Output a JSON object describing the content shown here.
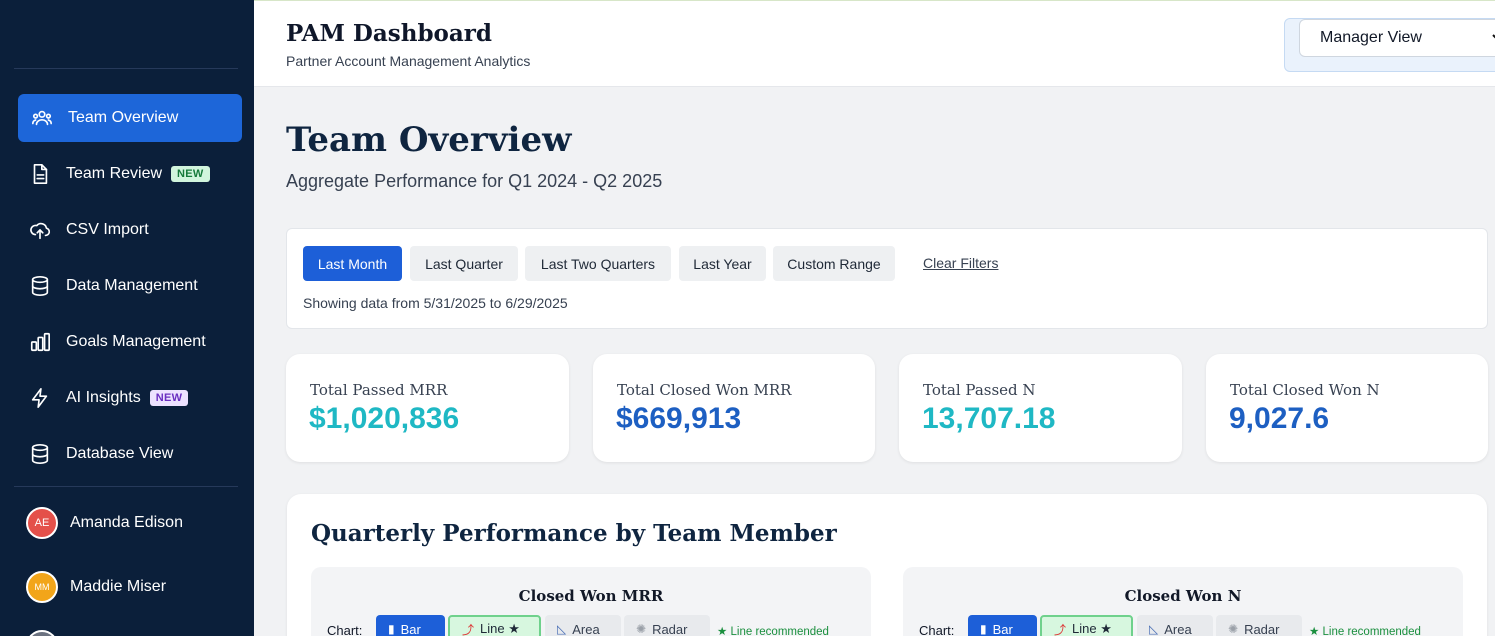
{
  "sidebar": {
    "items": [
      {
        "label": "Team Overview",
        "icon": "users-icon",
        "badge": ""
      },
      {
        "label": "Team Review",
        "icon": "document-icon",
        "badge": "NEW"
      },
      {
        "label": "CSV Import",
        "icon": "cloud-upload-icon",
        "badge": ""
      },
      {
        "label": "Data Management",
        "icon": "database-icon",
        "badge": ""
      },
      {
        "label": "Goals Management",
        "icon": "bar-chart-icon",
        "badge": ""
      },
      {
        "label": "AI Insights",
        "icon": "lightning-icon",
        "badge": "NEW"
      },
      {
        "label": "Database View",
        "icon": "database-icon",
        "badge": ""
      }
    ],
    "users": [
      {
        "initials": "AE",
        "name": "Amanda Edison",
        "color": "#e4504a"
      },
      {
        "initials": "MM",
        "name": "Maddie Miser",
        "color": "#f2a51a"
      }
    ]
  },
  "header": {
    "title": "PAM Dashboard",
    "subtitle": "Partner Account Management Analytics",
    "view_select": "Manager View"
  },
  "main": {
    "title": "Team Overview",
    "subtitle": "Aggregate Performance for Q1 2024 - Q2 2025",
    "filters": {
      "buttons": [
        "Last Month",
        "Last Quarter",
        "Last Two Quarters",
        "Last Year",
        "Custom Range"
      ],
      "active": "Last Month",
      "clear": "Clear Filters",
      "note": "Showing data from 5/31/2025 to 6/29/2025"
    },
    "kpis": [
      {
        "label": "Total Passed MRR",
        "value": "$1,020,836",
        "color": "#1fb8c4"
      },
      {
        "label": "Total Closed Won MRR",
        "value": "$669,913",
        "color": "#1d5fc2"
      },
      {
        "label": "Total Passed N",
        "value": "13,707.18",
        "color": "#1fb8c4"
      },
      {
        "label": "Total Closed Won N",
        "value": "9,027.6",
        "color": "#1d5fc2"
      }
    ],
    "performance": {
      "title": "Quarterly Performance by Team Member",
      "panels": [
        {
          "title": "Closed Won MRR"
        },
        {
          "title": "Closed Won N"
        }
      ],
      "chart_label": "Chart:",
      "chart_types": [
        "Bar",
        "Line ★",
        "Area",
        "Radar"
      ],
      "recommendation": "★ Line recommended"
    }
  }
}
